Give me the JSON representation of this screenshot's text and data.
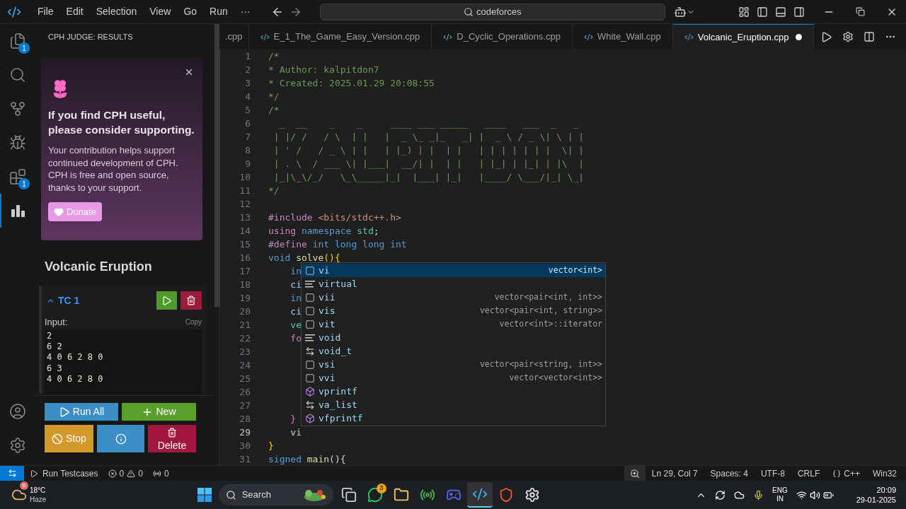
{
  "title_bar": {
    "menu": [
      "File",
      "Edit",
      "Selection",
      "View",
      "Go",
      "Run",
      "···"
    ],
    "search": "codeforces"
  },
  "activity_bar": {
    "top": [
      {
        "kind": "explorer",
        "selected": false,
        "badge": "1"
      },
      {
        "kind": "search",
        "selected": false
      },
      {
        "kind": "source_control",
        "selected": false
      },
      {
        "kind": "run_debug",
        "selected": false
      },
      {
        "kind": "extensions",
        "selected": false,
        "badge": "1"
      },
      {
        "kind": "cph",
        "selected": true
      }
    ],
    "bottom": [
      {
        "kind": "account",
        "selected": false
      },
      {
        "kind": "settings",
        "selected": false
      }
    ]
  },
  "sidebar": {
    "header": "CPH JUDGE: RESULTS",
    "support_card": {
      "title": "If you find CPH useful, please consider supporting.",
      "body": "Your contribution helps support continued development of CPH. CPH is free and open source, thanks to your support.",
      "button": "Donate"
    },
    "problem_title": "Volcanic Eruption",
    "testcases": [
      {
        "label": "TC 1",
        "expanded": true,
        "input_label": "Input:",
        "copy": "Copy",
        "input": [
          "2",
          "6 2",
          "4 0 6 2 8 0",
          "6 3",
          "4 0 6 2 8 0"
        ]
      }
    ],
    "buttons": [
      {
        "kind": "run_all",
        "label": "Run All"
      },
      {
        "kind": "new",
        "label": "New"
      },
      {
        "kind": "stop",
        "label": "Stop"
      },
      {
        "kind": "info"
      },
      {
        "kind": "delete",
        "label": "Delete"
      }
    ]
  },
  "tabs": [
    {
      "label": ".cpp",
      "selected": false,
      "modified": false
    },
    {
      "label": "E_1_The_Game_Easy_Version.cpp",
      "selected": false,
      "modified": false
    },
    {
      "label": "D_Cyclic_Operations.cpp",
      "selected": false,
      "modified": false
    },
    {
      "label": "White_Wall.cpp",
      "selected": false,
      "modified": false
    },
    {
      "label": "Volcanic_Eruption.cpp",
      "selected": true,
      "modified": true
    }
  ],
  "editor": {
    "lines": [
      {
        "number": "1",
        "current": false,
        "tokens": [
          {
            "kind": "comment",
            "text": "/*"
          }
        ]
      },
      {
        "number": "2",
        "current": false,
        "tokens": [
          {
            "kind": "comment",
            "text": "* Author: kalpitdon7"
          }
        ]
      },
      {
        "number": "3",
        "current": false,
        "tokens": [
          {
            "kind": "comment",
            "text": "* Created: 2025.01.29 20:08:55"
          }
        ]
      },
      {
        "number": "4",
        "current": false,
        "tokens": [
          {
            "kind": "comment",
            "text": "*/"
          }
        ]
      },
      {
        "number": "5",
        "current": false,
        "tokens": [
          {
            "kind": "comment",
            "text": "/*"
          }
        ]
      },
      {
        "number": "6",
        "current": false,
        "tokens": [
          {
            "kind": "comment",
            "text": "  _  __    _    _     ____ ___ _____   ____   ___  _   _ "
          }
        ]
      },
      {
        "number": "7",
        "current": false,
        "tokens": [
          {
            "kind": "comment",
            "text": " | |/ /   / \\  | |   |  _ \\_ _|_   _| |  _ \\ / _ \\| \\ | |"
          }
        ]
      },
      {
        "number": "8",
        "current": false,
        "tokens": [
          {
            "kind": "comment",
            "text": " | ' /   / _ \\ | |   | |_) | |  | |   | | | | | | |  \\| |"
          }
        ]
      },
      {
        "number": "9",
        "current": false,
        "tokens": [
          {
            "kind": "comment",
            "text": " | . \\  / ___ \\| |___|  __/| |  | |   | |_| | |_| | |\\  |"
          }
        ]
      },
      {
        "number": "10",
        "current": false,
        "tokens": [
          {
            "kind": "comment",
            "text": " |_|\\_\\/_/   \\_\\_____|_|  |___| |_|   |____/ \\___/|_| \\_|"
          }
        ]
      },
      {
        "number": "11",
        "current": false,
        "tokens": [
          {
            "kind": "comment",
            "text": "*/"
          }
        ]
      },
      {
        "number": "12",
        "current": false
      },
      {
        "number": "13",
        "current": false,
        "tokens": [
          {
            "kind": "preproc",
            "text": "#include"
          },
          {
            "kind": "string",
            "text": " <bits/stdc++.h>"
          }
        ]
      },
      {
        "number": "14",
        "current": false,
        "tokens": [
          {
            "kind": "control",
            "text": "using"
          },
          {
            "kind": "keyword",
            "text": " namespace"
          },
          {
            "kind": "type",
            "text": " std"
          },
          {
            "kind": "plain",
            "text": ";"
          }
        ]
      },
      {
        "number": "15",
        "current": false,
        "tokens": [
          {
            "kind": "preproc",
            "text": "#define"
          },
          {
            "kind": "keyword",
            "text": " int long long int"
          }
        ]
      },
      {
        "number": "16",
        "current": false,
        "tokens": [
          {
            "kind": "keyword",
            "text": "void"
          },
          {
            "kind": "function",
            "text": " solve"
          },
          {
            "kind": "bracket",
            "text": "()"
          },
          {
            "kind": "bracket",
            "text": "{"
          }
        ]
      },
      {
        "number": "17",
        "current": false,
        "tokens": [
          {
            "kind": "keyword",
            "text": "    in"
          }
        ]
      },
      {
        "number": "18",
        "current": false,
        "tokens": [
          {
            "kind": "variable",
            "text": "    ci"
          }
        ]
      },
      {
        "number": "19",
        "current": false,
        "tokens": [
          {
            "kind": "keyword",
            "text": "    in"
          }
        ]
      },
      {
        "number": "20",
        "current": false,
        "tokens": [
          {
            "kind": "variable",
            "text": "    ci"
          }
        ]
      },
      {
        "number": "21",
        "current": false,
        "tokens": [
          {
            "kind": "type",
            "text": "    ve"
          }
        ]
      },
      {
        "number": "22",
        "current": false,
        "tokens": [
          {
            "kind": "control",
            "text": "    fo"
          }
        ]
      },
      {
        "number": "23",
        "current": false
      },
      {
        "number": "24",
        "current": false
      },
      {
        "number": "25",
        "current": false
      },
      {
        "number": "26",
        "current": false
      },
      {
        "number": "27",
        "current": false
      },
      {
        "number": "28",
        "current": false,
        "tokens": [
          {
            "kind": "bracket2",
            "text": "    }"
          }
        ]
      },
      {
        "number": "29",
        "current": true,
        "tokens": [
          {
            "kind": "plain",
            "text": "    vi"
          }
        ]
      },
      {
        "number": "30",
        "current": false,
        "tokens": [
          {
            "kind": "bracket",
            "text": "}"
          }
        ]
      },
      {
        "number": "31",
        "current": false,
        "tokens": [
          {
            "kind": "keyword",
            "text": "signed"
          },
          {
            "kind": "function",
            "text": " main"
          },
          {
            "kind": "plain",
            "text": "(){"
          }
        ]
      }
    ]
  },
  "suggest": {
    "items": [
      {
        "kind": "snippet",
        "label": "vi",
        "detail": "vector<int>",
        "selected": true
      },
      {
        "kind": "keyword",
        "label": "virtual",
        "selected": false
      },
      {
        "kind": "snippet",
        "label": "vii",
        "detail": "vector<pair<int, int>>",
        "selected": false
      },
      {
        "kind": "snippet",
        "label": "vis",
        "detail": "vector<pair<int, string>>",
        "selected": false
      },
      {
        "kind": "snippet",
        "label": "vit",
        "detail": "vector<int>::iterator",
        "selected": false
      },
      {
        "kind": "keyword",
        "label": "void",
        "selected": false
      },
      {
        "kind": "typedef",
        "label": "void_t",
        "selected": false
      },
      {
        "kind": "snippet",
        "label": "vsi",
        "detail": "vector<pair<string, int>>",
        "selected": false
      },
      {
        "kind": "snippet",
        "label": "vvi",
        "detail": "vector<vector<int>>",
        "selected": false
      },
      {
        "kind": "function",
        "label": "vprintf",
        "selected": false
      },
      {
        "kind": "typedef",
        "label": "va_list",
        "selected": false
      },
      {
        "kind": "function",
        "label": "vfprintf",
        "selected": false
      }
    ]
  },
  "status_bar": {
    "run": "Run Testcases",
    "errors": "0",
    "warnings": "0",
    "ports": "0",
    "right": [
      "Ln 29, Col 7",
      "Spaces: 4",
      "UTF-8",
      "CRLF",
      "C++",
      "Win32"
    ]
  },
  "taskbar": {
    "weather": {
      "temperature": "18°C",
      "condition": "Haze",
      "badge": "6"
    },
    "search": "Search",
    "apps": [
      {
        "kind": "task_view",
        "selected": false
      },
      {
        "kind": "whatsapp",
        "selected": false,
        "badge": "3"
      },
      {
        "kind": "files",
        "selected": false
      },
      {
        "kind": "chrome",
        "selected": false
      },
      {
        "kind": "discord",
        "selected": false
      },
      {
        "kind": "vscode",
        "selected": true
      },
      {
        "kind": "brave",
        "selected": false
      },
      {
        "kind": "chatgpt",
        "selected": false
      }
    ],
    "language": "ENG",
    "region": "IN",
    "time": "20:09",
    "date": "29-01-2025"
  }
}
